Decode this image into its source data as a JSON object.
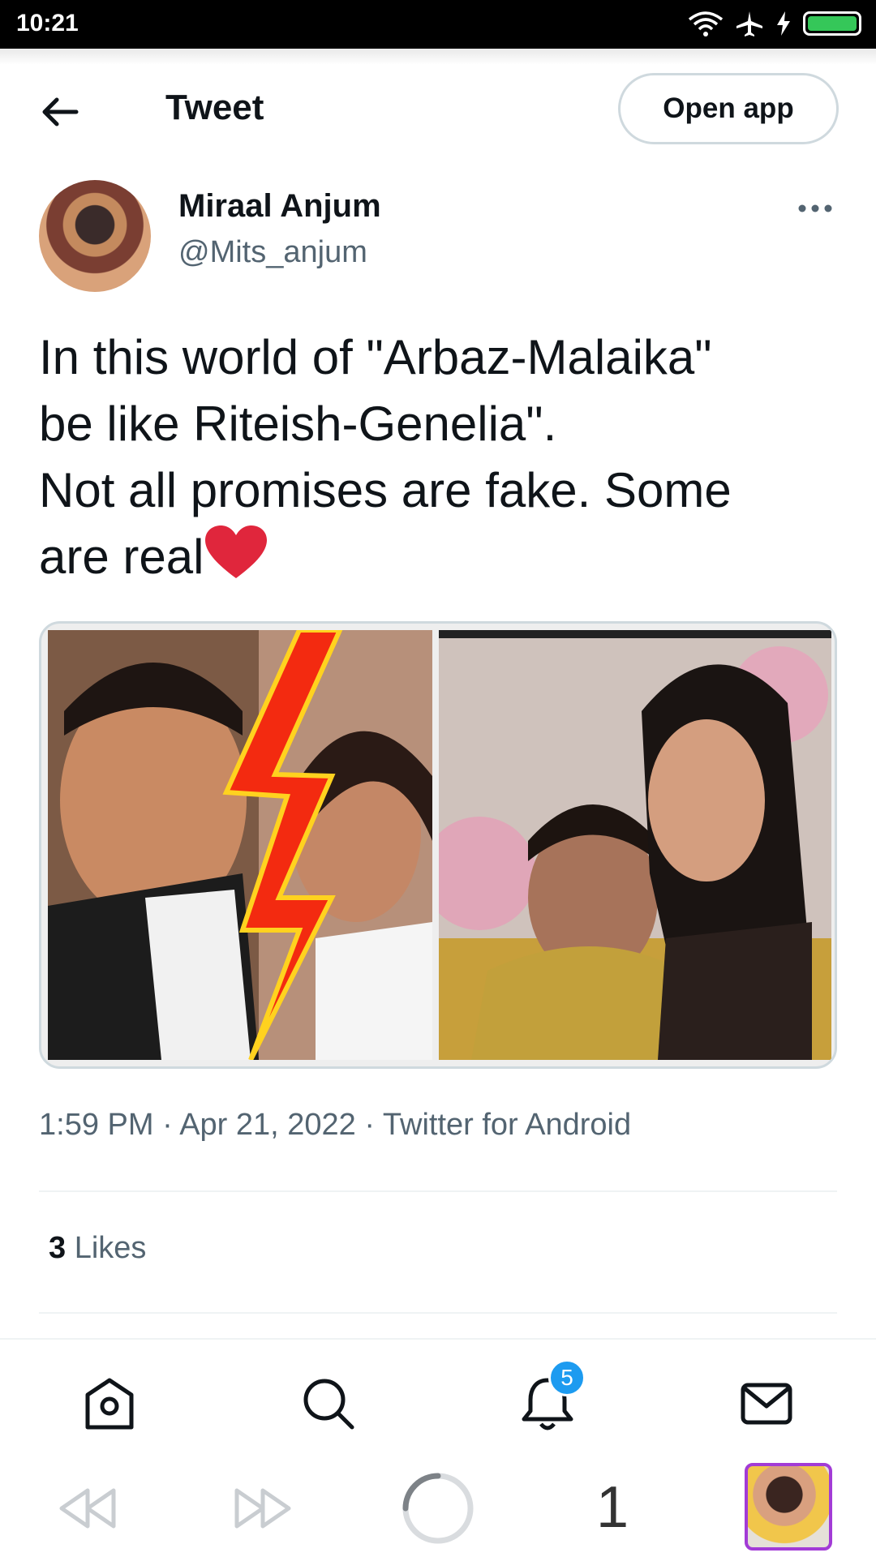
{
  "status_bar": {
    "time": "10:21"
  },
  "header": {
    "title": "Tweet",
    "open_app_label": "Open app"
  },
  "author": {
    "name": "Miraal Anjum",
    "handle": "@Mits_anjum"
  },
  "tweet": {
    "text": "In this world of \"Arbaz-Malaika\"\nbe like Riteish-Genelia\".\nNot all promises are fake. Some\nare real"
  },
  "meta": {
    "timestamp": "1:59 PM · Apr 21, 2022 · Twitter for Android"
  },
  "stats": {
    "likes_count": "3",
    "likes_label": "Likes"
  },
  "bottom_nav": {
    "items": [
      "home-icon",
      "search-icon",
      "notifications-icon",
      "messages-icon"
    ],
    "notification_badge": "5"
  },
  "system_bar": {
    "tab_count": "1"
  },
  "colors": {
    "accent": "#1d9bf0",
    "heart": "#e0263c",
    "secondary_text": "#536471"
  }
}
